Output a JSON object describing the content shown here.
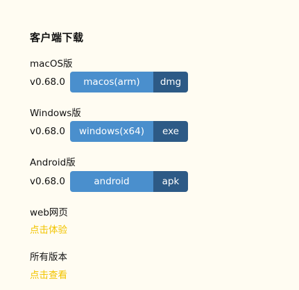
{
  "title": "客户端下载",
  "downloads": [
    {
      "platform_label": "macOS版",
      "version": "v0.68.0",
      "button_label": "macos(arm)",
      "ext_label": "dmg"
    },
    {
      "platform_label": "Windows版",
      "version": "v0.68.0",
      "button_label": "windows(x64)",
      "ext_label": "exe"
    },
    {
      "platform_label": "Android版",
      "version": "v0.68.0",
      "button_label": "android",
      "ext_label": "apk"
    }
  ],
  "web": {
    "label": "web网页",
    "link": "点击体验"
  },
  "all_versions": {
    "label": "所有版本",
    "link": "点击查看"
  },
  "colors": {
    "background": "#fffcf2",
    "button_primary": "#4a8fcd",
    "button_secondary": "#2d5a86",
    "link": "#f2c400"
  }
}
